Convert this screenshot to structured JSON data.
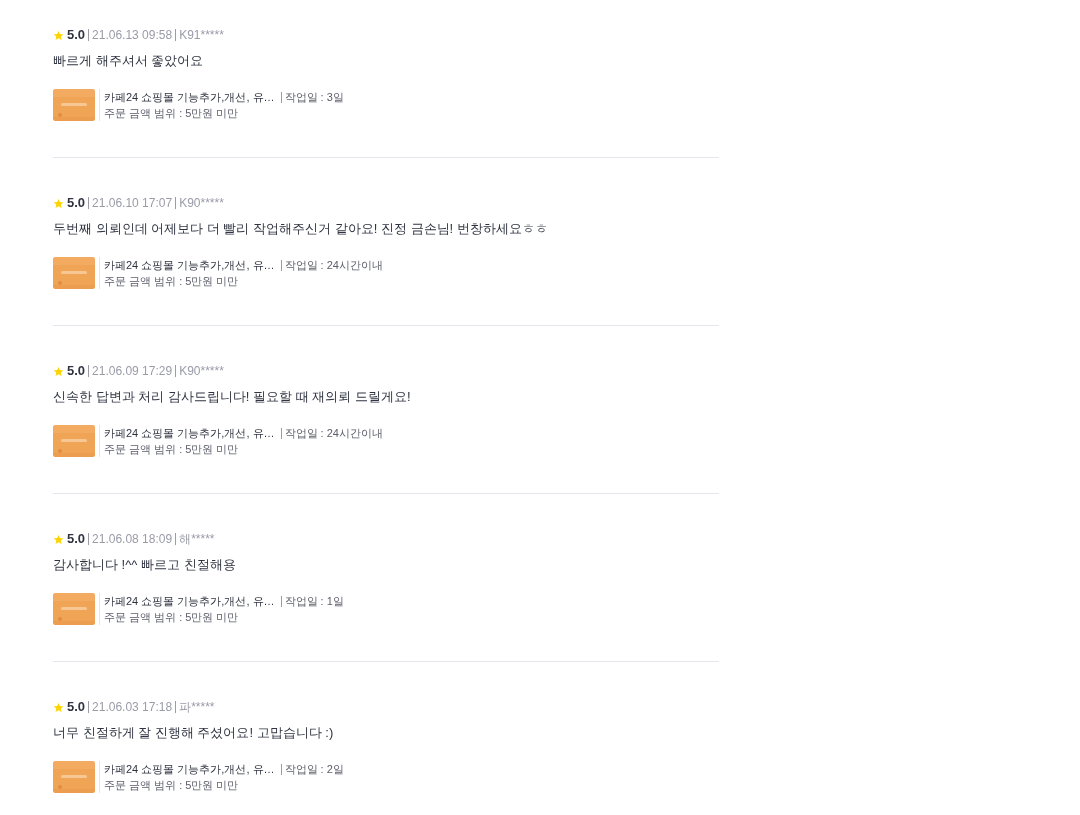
{
  "reviews": [
    {
      "rating": "5.0",
      "date": "21.06.13 09:58",
      "user": "K91*****",
      "comment": "빠르게 해주셔서 좋았어요",
      "product": {
        "title": "카페24 쇼핑몰 기능추가,개선, 유…",
        "work_days": "작업일 : 3일",
        "price_range": "주문 금액 범위 : 5만원 미만"
      }
    },
    {
      "rating": "5.0",
      "date": "21.06.10 17:07",
      "user": "K90*****",
      "comment": "두번째 의뢰인데 어제보다 더 빨리 작업해주신거 같아요! 진정 금손님! 번창하세요ㅎㅎ",
      "product": {
        "title": "카페24 쇼핑몰 기능추가,개선, 유…",
        "work_days": "작업일 : 24시간이내",
        "price_range": "주문 금액 범위 : 5만원 미만"
      }
    },
    {
      "rating": "5.0",
      "date": "21.06.09 17:29",
      "user": "K90*****",
      "comment": "신속한 답변과 처리 감사드립니다! 필요할 때 재의뢰 드릴게요!",
      "product": {
        "title": "카페24 쇼핑몰 기능추가,개선, 유…",
        "work_days": "작업일 : 24시간이내",
        "price_range": "주문 금액 범위 : 5만원 미만"
      }
    },
    {
      "rating": "5.0",
      "date": "21.06.08 18:09",
      "user": "해*****",
      "comment": "감사합니다 !^^ 빠르고 친절해용",
      "product": {
        "title": "카페24 쇼핑몰 기능추가,개선, 유…",
        "work_days": "작업일 : 1일",
        "price_range": "주문 금액 범위 : 5만원 미만"
      }
    },
    {
      "rating": "5.0",
      "date": "21.06.03 17:18",
      "user": "파*****",
      "comment": "너무 친절하게 잘 진행해 주셨어요! 고맙습니다 :)",
      "product": {
        "title": "카페24 쇼핑몰 기능추가,개선, 유…",
        "work_days": "작업일 : 2일",
        "price_range": "주문 금액 범위 : 5만원 미만"
      }
    }
  ]
}
